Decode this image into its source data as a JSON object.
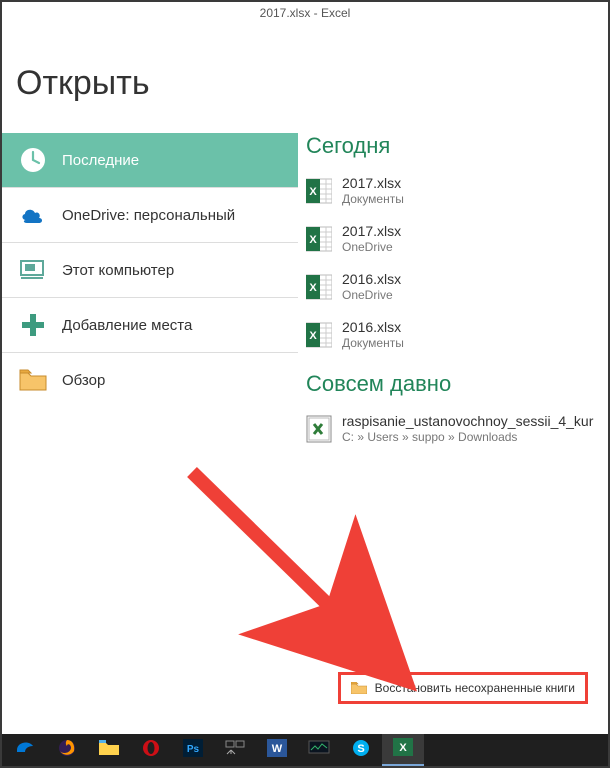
{
  "titlebar": "2017.xlsx - Excel",
  "header": "Открыть",
  "nav": [
    {
      "id": "recent",
      "label": "Последние",
      "active": true
    },
    {
      "id": "onedrive",
      "label": "OneDrive: персональный",
      "active": false
    },
    {
      "id": "thispc",
      "label": "Этот компьютер",
      "active": false
    },
    {
      "id": "addplace",
      "label": "Добавление места",
      "active": false
    },
    {
      "id": "browse",
      "label": "Обзор",
      "active": false
    }
  ],
  "sections": [
    {
      "title": "Сегодня",
      "items": [
        {
          "name": "2017.xlsx",
          "loc": "Документы"
        },
        {
          "name": "2017.xlsx",
          "loc": "OneDrive"
        },
        {
          "name": "2016.xlsx",
          "loc": "OneDrive"
        },
        {
          "name": "2016.xlsx",
          "loc": "Документы"
        }
      ]
    },
    {
      "title": "Совсем давно",
      "items": [
        {
          "name": "raspisanie_ustanovochnoy_sessii_4_kur",
          "loc": "C: » Users » suppo » Downloads",
          "old": true
        }
      ]
    }
  ],
  "recover_label": "Восстановить несохраненные книги",
  "colors": {
    "accent": "#218559",
    "active_bg": "#6bc1a9",
    "highlight": "#ef4037"
  },
  "taskbar": [
    {
      "id": "edge",
      "color": "#0078d7"
    },
    {
      "id": "firefox",
      "color": "#ff9500"
    },
    {
      "id": "explorer",
      "color": "#ffd24d"
    },
    {
      "id": "opera",
      "color": "#cc0f16"
    },
    {
      "id": "photoshop",
      "color": "#001e36"
    },
    {
      "id": "tasks",
      "color": "#888"
    },
    {
      "id": "word",
      "color": "#2b579a"
    },
    {
      "id": "monitor",
      "color": "#3a3a3a"
    },
    {
      "id": "skype",
      "color": "#00aff0"
    },
    {
      "id": "excel",
      "color": "#217346",
      "active": true
    }
  ]
}
